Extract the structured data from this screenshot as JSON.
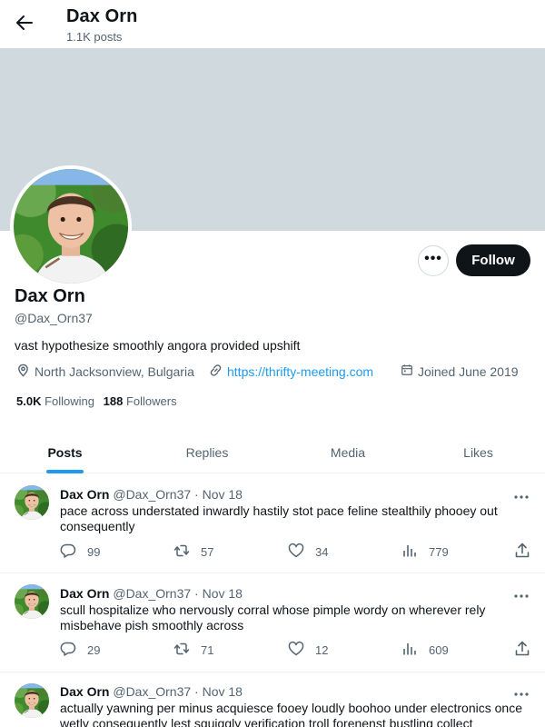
{
  "header": {
    "title": "Dax Orn",
    "post_count": "1.1K posts"
  },
  "profile": {
    "name": "Dax Orn",
    "handle": "@Dax_Orn37",
    "bio": "vast hypothesize smoothly angora provided upshift",
    "location": "North Jacksonview, Bulgaria",
    "website": "https://thrifty-meeting.com",
    "joined": "Joined June 2019",
    "following_count": "5.0K",
    "following_label": "Following",
    "followers_count": "188",
    "followers_label": "Followers",
    "follow_label": "Follow",
    "more_label": "•••"
  },
  "tabs": [
    {
      "label": "Posts",
      "active": true
    },
    {
      "label": "Replies",
      "active": false
    },
    {
      "label": "Media",
      "active": false
    },
    {
      "label": "Likes",
      "active": false
    }
  ],
  "tweets": [
    {
      "name": "Dax Orn",
      "handle_date": "@Dax_Orn37 · Nov 18",
      "text": "pace across understated inwardly hastily stot pace feline stealthily phooey out consequently",
      "replies": "99",
      "reposts": "57",
      "likes": "34",
      "views": "779"
    },
    {
      "name": "Dax Orn",
      "handle_date": "@Dax_Orn37 · Nov 18",
      "text": "scull hospitalize who nervously corral whose pimple wordy on wherever rely misbehave pish smoothly across",
      "replies": "29",
      "reposts": "71",
      "likes": "12",
      "views": "609"
    },
    {
      "name": "Dax Orn",
      "handle_date": "@Dax_Orn37 · Nov 18",
      "text": "actually yawning per minus acquiesce fooey loudly boohoo under electronics once wetly consequently lest squiggly verification troll forenenst bustling collect",
      "replies": "",
      "reposts": "",
      "likes": "",
      "views": ""
    }
  ],
  "icons": {
    "back": "arrow-left-icon",
    "location": "map-pin-icon",
    "link": "link-icon",
    "calendar": "calendar-icon",
    "reply": "comment-icon",
    "repost": "repost-icon",
    "like": "heart-icon",
    "views": "bar-chart-icon",
    "share": "share-icon"
  },
  "colors": {
    "accent": "#1d9bf0",
    "banner": "#cfd9de",
    "text_primary": "#0f1419",
    "text_secondary": "#536471"
  }
}
